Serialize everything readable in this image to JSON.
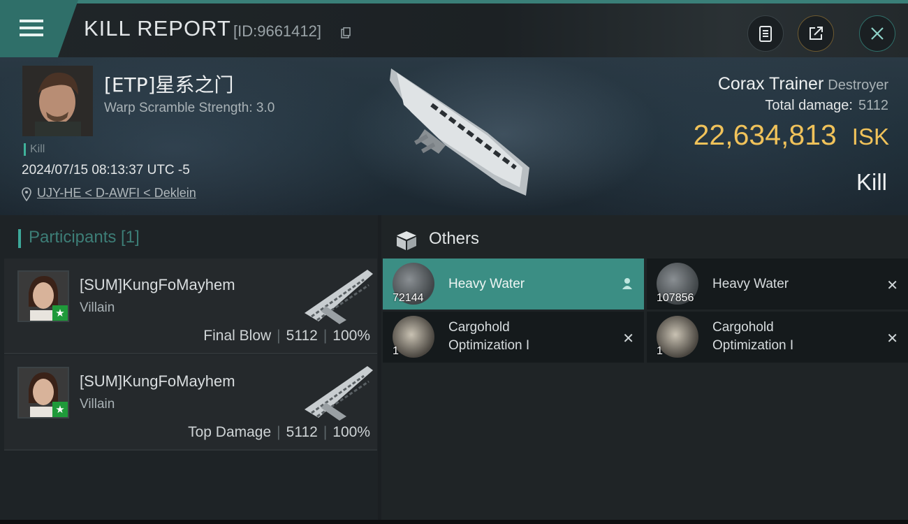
{
  "header": {
    "title": "KILL REPORT",
    "report_id": "[ID:9661412]",
    "icons": [
      "menu-icon",
      "clipboard-icon",
      "share-icon",
      "close-icon"
    ]
  },
  "victim": {
    "name": "[ETP]星系之门",
    "warp_scramble": "Warp Scramble Strength: 3.0",
    "tag": "Kill",
    "datetime": "2024/07/15 08:13:37 UTC -5",
    "location": "UJY-HE < D-AWFI < Deklein",
    "ship_name": "Corax Trainer",
    "ship_class": "Destroyer",
    "total_damage_label": "Total damage:",
    "total_damage_value": "5112",
    "isk_amount": "22,634,813",
    "isk_unit": "ISK",
    "result": "Kill"
  },
  "participants": {
    "header": "Participants [1]",
    "items": [
      {
        "name": "[SUM]KungFoMayhem",
        "role": "Villain",
        "label": "Final Blow",
        "damage": "5112",
        "percent": "100%"
      },
      {
        "name": "[SUM]KungFoMayhem",
        "role": "Villain",
        "label": "Top Damage",
        "damage": "5112",
        "percent": "100%"
      }
    ]
  },
  "others": {
    "header": "Others",
    "items": [
      {
        "name": "Heavy Water",
        "qty": "72144",
        "status": "dropped",
        "flag": "person-icon"
      },
      {
        "name": "Heavy Water",
        "qty": "107856",
        "status": "destroyed",
        "flag": "x-icon"
      },
      {
        "name": "Cargohold Optimization I",
        "line1": "Cargohold",
        "line2": "Optimization I",
        "qty": "1",
        "status": "destroyed",
        "flag": "x-icon"
      },
      {
        "name": "Cargohold Optimization I",
        "line1": "Cargohold",
        "line2": "Optimization I",
        "qty": "1",
        "status": "destroyed",
        "flag": "x-icon"
      }
    ],
    "colors": {
      "active": "#3b8e84",
      "isk": "#f0c25a",
      "accent": "#3da89a"
    }
  }
}
